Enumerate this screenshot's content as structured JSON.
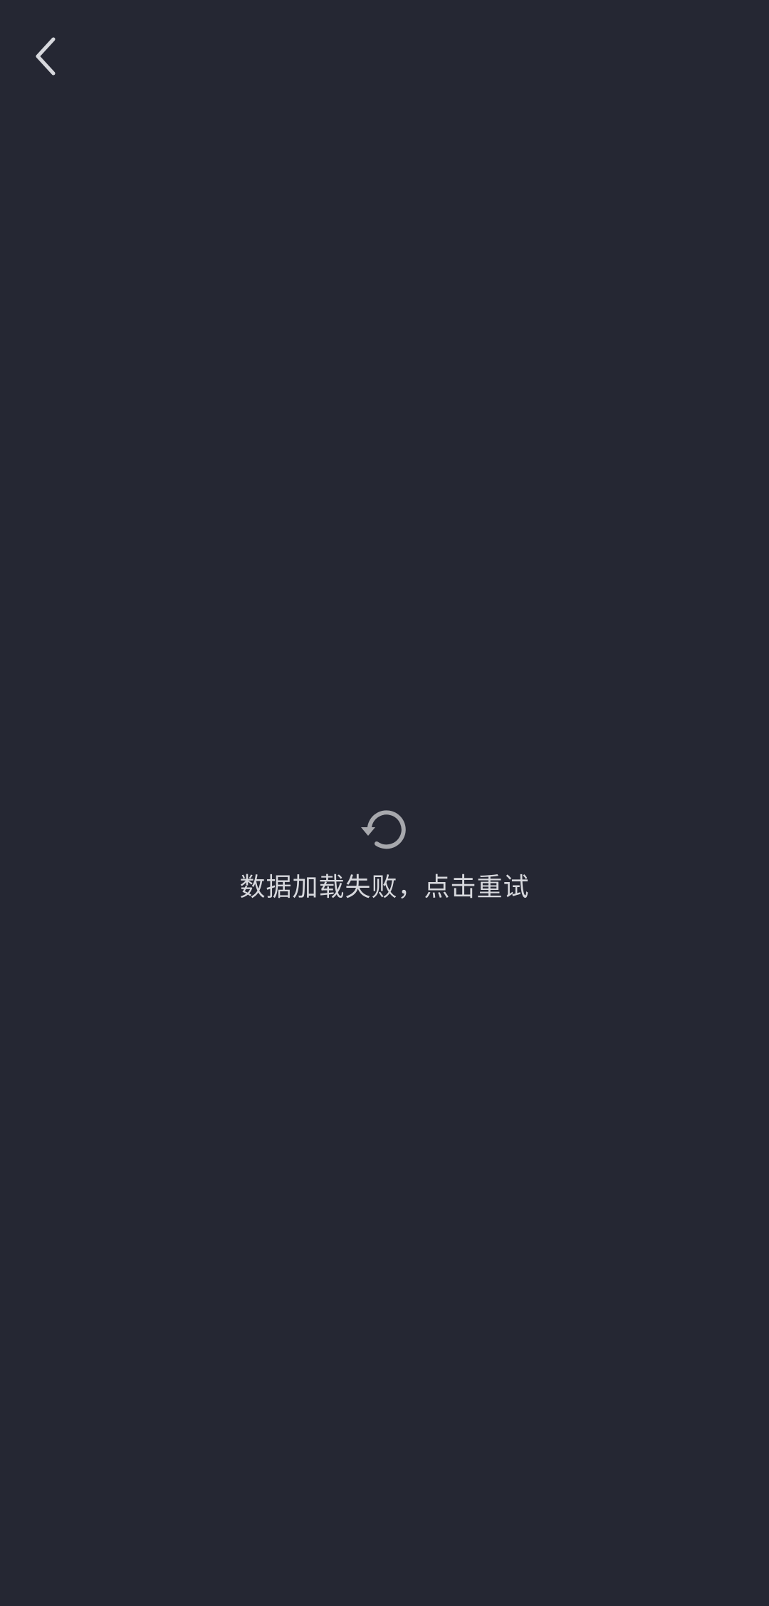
{
  "header": {
    "back_icon": "chevron-left-icon"
  },
  "error_state": {
    "retry_icon": "refresh-icon",
    "message": "数据加载失败，点击重试"
  },
  "colors": {
    "background": "#252733",
    "icon_light": "#d7d8dd",
    "icon_gray": "#a7a8ad"
  }
}
